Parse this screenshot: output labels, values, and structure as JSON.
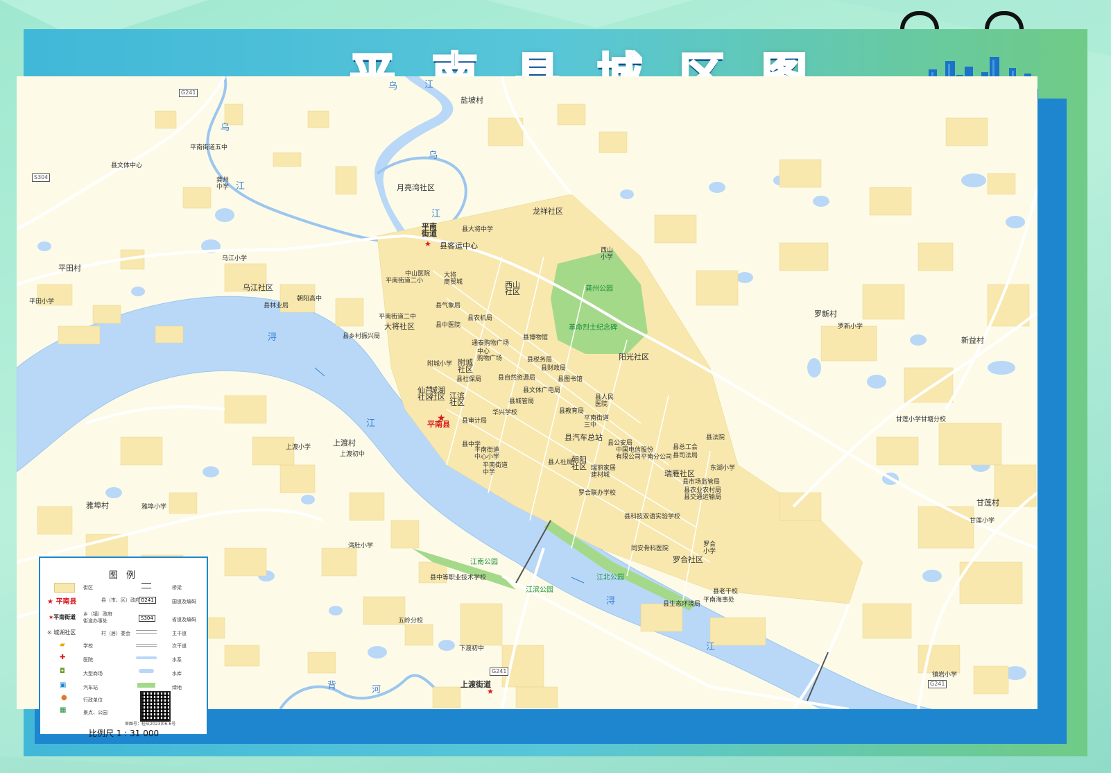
{
  "title_chars": [
    "平",
    "南",
    "县",
    "城",
    "区",
    "图"
  ],
  "colors": {
    "water": "#b9d8f7",
    "built_area": "#f8e8ae",
    "park": "#a5d98a",
    "frame_blue": "#1d86cf",
    "title_blue": "#1c6fc4",
    "road": "#ffffff"
  },
  "labels": {
    "pingnan_county": "平南县",
    "pingnan_subdistrict": "平南\n街道",
    "shangdu_subdistrict": "上渡街道",
    "yanpo": "盐坡村",
    "chengxiang_wu": "平南街道五中",
    "wenti": "县文体中心",
    "gongzhou_zhong": "龚州\n中学",
    "yueliangwan": "月亮湾社区",
    "daxiang_zhong": "县大将中学",
    "keyun": "县客运中心",
    "longxiang": "龙祥社区",
    "pingtian": "平田村",
    "wujiang_xiaoxue": "乌江小学",
    "wujiang_shequ": "乌江社区",
    "zhaoyang_gaozhong": "朝阳高中",
    "pingtian_xiaoxue": "平田小学",
    "linye": "县林业局",
    "zhongshan_yiyuan": "中山医院",
    "daxiang_shangmao": "大将\n商贸城",
    "erxiao": "平南街道二小",
    "qixiang": "县气象局",
    "xishan_xiaoxue": "西山\n小学",
    "gongzhou_park": "龚州公园",
    "xishan_shequ": "西山\n社区",
    "nongji": "县农机局",
    "erzhong": "平南街道二中",
    "daxiang_shequ": "大将社区",
    "zhongyiyuan": "县中医院",
    "xiangcun": "县乡村振兴局",
    "martyrs": "革命烈士纪念碑",
    "museum": "县博物馆",
    "tongtai": "通泰购物广场",
    "zhongxin_gouwu": "中心\n购物广场",
    "shuiwu": "县税务局",
    "caizheng": "县财政局",
    "yangguang": "阳光社区",
    "luoxin": "罗新村",
    "luoxin_xiaoxue": "罗新小学",
    "xinyi": "新益村",
    "fucheng_xiaoxue": "附城小学",
    "fucheng_shequ": "附城\n社区",
    "yibao": "县社保局",
    "ziran": "县自然资源局",
    "library": "县图书馆",
    "wenti_guangdian": "县文体广电局",
    "shichengjian": "县城管局",
    "renmin_yiyuan": "县人民\n医院",
    "xianlu_shequ": "仙芦\n社区",
    "chenghu_shequ": "城湖\n社区",
    "jiangbin_shequ": "江滨\n社区",
    "huaxing": "华兴学校",
    "jiaoyu": "县教育局",
    "sanzhong": "平南街道\n三中",
    "shenji": "县审计局",
    "qiche_zongzhan": "县汽车总站",
    "gongan": "县公安局",
    "shangdu_cun": "上渡村",
    "shangdu_xiaoxue": "上渡小学",
    "shangdu_chuzhong": "上渡初中",
    "xian_zhong": "县中学",
    "zhongxin_xiaoxue": "平南街道\n中心小学",
    "pingnan_zhongxue": "平南街道\n中学",
    "renshe": "县人社局",
    "zhaoyang_shequ": "朝阳\n社区",
    "ruilian_jiacai": "瑞丽家居\n建材城",
    "dianxin": "中国电信股份\n有限公司平南分公司",
    "zonggonghui": "县总工会",
    "sifa": "县司法局",
    "fayuan": "县法院",
    "dongyuan_xiaoxue": "东湖小学",
    "ruiyan_shequ": "瑞雁社区",
    "shichang_jianguan": "县市场监管局",
    "nongye": "县农业农村局",
    "jiaotong": "县交通运输局",
    "yapu": "雅埠村",
    "yapu_xiaoxue": "雅埠小学",
    "luohe_xuexiao": "罗合联办学校",
    "keji_shiyan": "县科技双语实验学校",
    "tongan_yiyuan": "同安骨科医院",
    "luohe_xiaoxue": "罗合\n小学",
    "luohe_shequ": "罗合社区",
    "ganlian": "甘莲村",
    "ganlian_xiaoxue": "甘莲小学",
    "ganlian_fenxiao": "甘莲小学甘塘分校",
    "wanduxiaoxue": "湾肚小学",
    "jiangnan_park": "江南公园",
    "zhongzhi": "县中等职业技术学校",
    "jiangbin_park": "江滨公园",
    "jiangbei_park": "江北公园",
    "shengtai": "县生态环境局",
    "haishi": "平南海事处",
    "laoxiao": "县老干校",
    "wuling": "五岭分校",
    "xiadu_chuzhong": "下渡初中",
    "hanyan_xiaoxue": "镇岩小学"
  },
  "rivers": {
    "xun_1": "浔",
    "xun_2": "浔",
    "jiang_1": "江",
    "jiang_2": "江",
    "jiang_3": "江",
    "wu_1": "乌",
    "wu_2": "乌",
    "wu_3": "乌",
    "wu_jiang_a": "江",
    "wu_jiang_b": "江",
    "bei_he": "背",
    "bei_he_2": "河"
  },
  "roads": {
    "g241_a": "G241",
    "g241_b": "G241",
    "s304": "S304",
    "g241_c": "G241"
  },
  "legend": {
    "title": "图  例",
    "items": [
      {
        "sym": "",
        "label": "街区"
      },
      {
        "sym": "平南县",
        "label": "县（市、区）政府"
      },
      {
        "sym": "平南街道",
        "label": "乡（镇）政府\n街道办事处"
      },
      {
        "sym": "城湖社区",
        "label": "村（居）委会"
      },
      {
        "sym": "",
        "label": "学校"
      },
      {
        "sym": "",
        "label": "医院"
      },
      {
        "sym": "",
        "label": "大型商场"
      },
      {
        "sym": "",
        "label": "汽车站"
      },
      {
        "sym": "",
        "label": "行政单位"
      },
      {
        "sym": "",
        "label": "景点、公园"
      }
    ],
    "right_items": [
      {
        "sym": "",
        "label": "桥梁"
      },
      {
        "sym": "G241",
        "label": "国道及编码"
      },
      {
        "sym": "S304",
        "label": "省道及编码"
      },
      {
        "sym": "",
        "label": "主干道"
      },
      {
        "sym": "",
        "label": "次干道"
      },
      {
        "sym": "",
        "label": "水系"
      },
      {
        "sym": "",
        "label": "水库"
      },
      {
        "sym": "",
        "label": "绿地"
      }
    ],
    "approval": "审图号：桂S(2023)06-6号",
    "scale": "比例尺  1 : 31 000"
  }
}
